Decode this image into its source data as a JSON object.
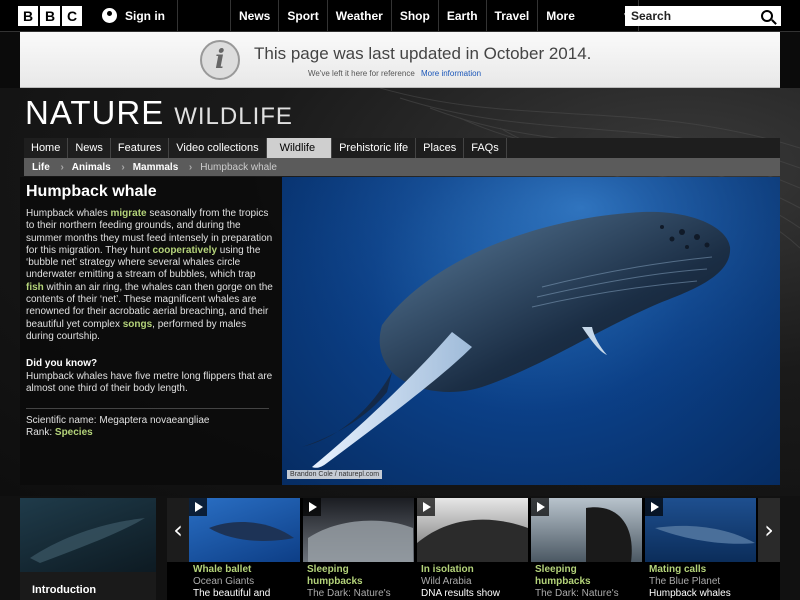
{
  "topbar": {
    "logo_letters": [
      "B",
      "B",
      "C"
    ],
    "signin_label": "Sign in",
    "nav": [
      "News",
      "Sport",
      "Weather",
      "Shop",
      "Earth",
      "Travel"
    ],
    "more_label": "More",
    "search_placeholder": "Search"
  },
  "banner": {
    "message": "This page was last updated in October 2014.",
    "sub": "We've left it here for reference",
    "link": "More information"
  },
  "brand": {
    "title": "NATURE",
    "subtitle": "WILDLIFE"
  },
  "section_nav": [
    "Home",
    "News",
    "Features",
    "Video collections",
    "Wildlife",
    "Prehistoric life",
    "Places",
    "FAQs"
  ],
  "section_nav_active": "Wildlife",
  "breadcrumb": {
    "links": [
      "Life",
      "Animals",
      "Mammals"
    ],
    "current": "Humpback whale"
  },
  "article": {
    "title": "Humpback whale",
    "desc_parts": [
      {
        "text": "Humpback whales ",
        "hl": false
      },
      {
        "text": "migrate",
        "hl": true
      },
      {
        "text": " seasonally from the tropics to their northern feeding grounds, and during the summer months they must feed intensely in preparation for this migration. They hunt ",
        "hl": false
      },
      {
        "text": "cooperatively",
        "hl": true
      },
      {
        "text": " using the ‘bubble net’ strategy where several whales circle underwater emitting a stream of bubbles, which trap ",
        "hl": false
      },
      {
        "text": "fish",
        "hl": true
      },
      {
        "text": " within an air ring, the whales can then gorge on the contents of their ‘net’. These magnificent whales are renowned for their acrobatic aerial breaching, and their beautiful yet complex ",
        "hl": false
      },
      {
        "text": "songs",
        "hl": true
      },
      {
        "text": ", performed by males during courtship.",
        "hl": false
      }
    ],
    "dyk_heading": "Did you know?",
    "dyk_text": "Humpback whales have five metre long flippers that are almost one third of their body length.",
    "sci_label": "Scientific name:",
    "sci_value": "Megaptera novaeangliae",
    "rank_label": "Rank:",
    "rank_value": "Species"
  },
  "photo": {
    "credit": "Brandon Cole / naturepl.com"
  },
  "carousel": {
    "intro_label": "Introduction",
    "items": [
      {
        "title": "Whale ballet",
        "source": "Ocean Giants",
        "desc": "The beautiful and"
      },
      {
        "title": "Sleeping humpbacks",
        "source": "The Dark: Nature's",
        "desc": ""
      },
      {
        "title": "In isolation",
        "source": "Wild Arabia",
        "desc": "DNA results show"
      },
      {
        "title": "Sleeping humpbacks",
        "source": "The Dark: Nature's",
        "desc": ""
      },
      {
        "title": "Mating calls",
        "source": "The Blue Planet",
        "desc": "Humpback whales"
      }
    ]
  },
  "colors": {
    "highlight": "#b4d37a",
    "link": "#1a56b8"
  }
}
